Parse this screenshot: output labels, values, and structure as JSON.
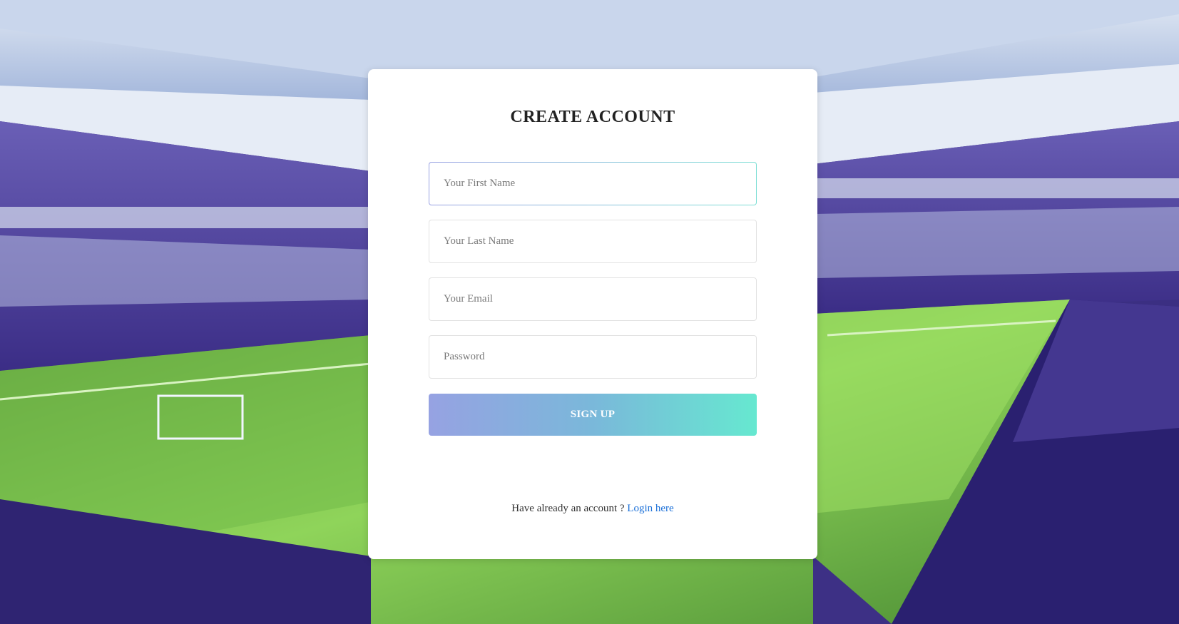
{
  "form": {
    "title": "CREATE ACCOUNT",
    "first_name": {
      "value": "",
      "placeholder": "Your First Name"
    },
    "last_name": {
      "value": "",
      "placeholder": "Your Last Name"
    },
    "email": {
      "value": "",
      "placeholder": "Your Email"
    },
    "password": {
      "value": "",
      "placeholder": "Password"
    },
    "submit_label": "SIGN UP",
    "footer_text": "Have already an account ? ",
    "login_link": "Login here"
  },
  "colors": {
    "button_gradient_start": "#96a2e2",
    "button_gradient_end": "#66e8d0",
    "link": "#1a6fd8",
    "title": "#222222"
  }
}
